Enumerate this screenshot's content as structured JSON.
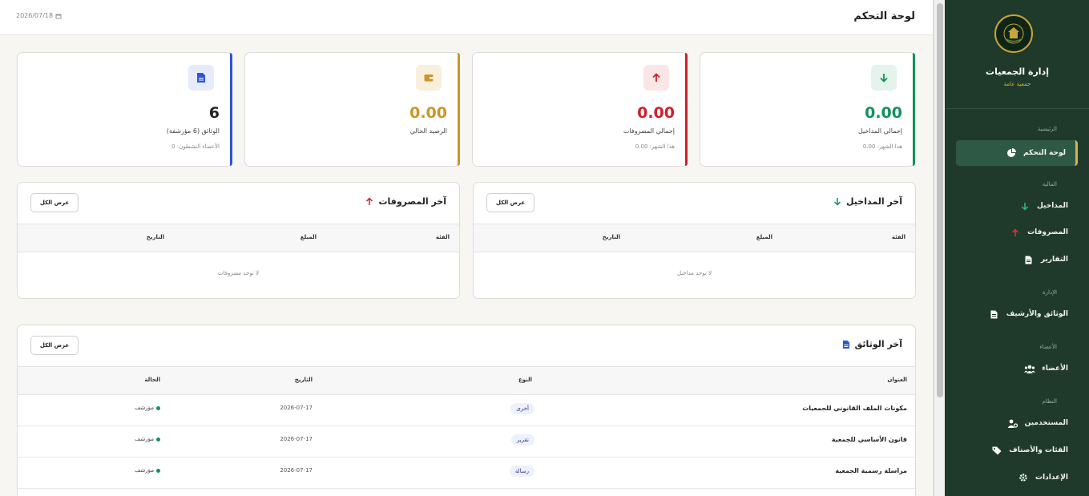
{
  "header": {
    "title": "لوحة التحكم",
    "date": "2026/07/18"
  },
  "stats": [
    {
      "value": "0.00",
      "label": "إجمالي المداخيل",
      "sub": "هذا الشهر: 0.00",
      "color": "#12925a",
      "icon": "arrow-down-icon"
    },
    {
      "value": "0.00",
      "label": "إجمالي المصروفات",
      "sub": "هذا الشهر: 0.00",
      "color": "#d11f2a",
      "icon": "arrow-up-icon"
    },
    {
      "value": "0.00",
      "label": "الرصيد الحالي",
      "sub": "",
      "color": "#c9962a",
      "icon": "wallet-icon"
    },
    {
      "value": "6",
      "label": "الوثائق (6 مؤرشفة)",
      "sub": "الأعضاء النشطون: 0",
      "color": "#2f55d4",
      "icon": "document-icon"
    }
  ],
  "income_panel": {
    "title": "آخر المداخيل",
    "button": "عرض الكل",
    "columns": [
      "الفئة",
      "المبلغ",
      "التاريخ"
    ],
    "empty": "لا توجد مداخيل"
  },
  "expense_panel": {
    "title": "آخر المصروفات",
    "button": "عرض الكل",
    "columns": [
      "الفئة",
      "المبلغ",
      "التاريخ"
    ],
    "empty": "لا توجد مصروفات"
  },
  "docs_panel": {
    "title": "آخر الوثائق",
    "button": "عرض الكل",
    "columns": [
      "العنوان",
      "النوع",
      "التاريخ",
      "الحالة"
    ],
    "rows": [
      {
        "title": "مكونات الملف القانوني للجمعيات",
        "type": "أخرى",
        "date": "2026-07-17",
        "status": "مؤرشف"
      },
      {
        "title": "قانون الأساسي للجمعية",
        "type": "تقرير",
        "date": "2026-07-17",
        "status": "مؤرشف"
      },
      {
        "title": "مراسلة رسمية الجمعية",
        "type": "رسالة",
        "date": "2026-07-17",
        "status": "مؤرشف"
      }
    ]
  },
  "sidebar": {
    "brand": "إدارة الجمعيات",
    "brand_sub": "جمعية عامة",
    "sections": [
      "الرئيسية",
      "المالية",
      "الإدارة",
      "الأعضاء",
      "النظام"
    ],
    "items": [
      {
        "label": "لوحة التحكم",
        "icon": "pie-chart-icon"
      },
      {
        "label": "المداخيل",
        "icon": "arrow-down-icon"
      },
      {
        "label": "المصروفات",
        "icon": "arrow-up-icon"
      },
      {
        "label": "التقارير",
        "icon": "report-icon"
      },
      {
        "label": "الوثائق والأرشيف",
        "icon": "document-icon"
      },
      {
        "label": "الأعضاء",
        "icon": "users-icon"
      },
      {
        "label": "المستخدمين",
        "icon": "user-gear-icon"
      },
      {
        "label": "الفئات والأصناف",
        "icon": "tag-icon"
      },
      {
        "label": "الإعدادات",
        "icon": "gear-icon"
      }
    ]
  }
}
